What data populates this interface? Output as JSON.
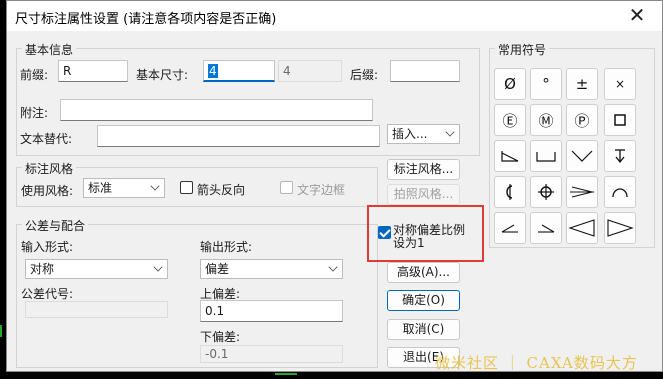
{
  "dialog": {
    "title": "尺寸标注属性设置 (请注意各项内容是否正确)",
    "close_glyph": "✕"
  },
  "basic_info": {
    "group_label": "基本信息",
    "prefix_label": "前缀:",
    "prefix_value": "R",
    "base_size_label": "基本尺寸:",
    "base_size_value": "4",
    "base_size_computed": "4",
    "suffix_label": "后缀:",
    "suffix_value": "",
    "note_label": "附注:",
    "note_value": "",
    "text_replace_label": "文本替代:",
    "text_replace_value": "",
    "insert_label": "插入..."
  },
  "annotation_style": {
    "group_label": "标注风格",
    "use_style_label": "使用风格:",
    "use_style_value": "标准",
    "arrow_reverse_label": "箭头反向",
    "arrow_reverse_checked": false,
    "text_border_label": "文字边框",
    "text_border_checked": false,
    "text_border_enabled": false,
    "style_button": "标注风格...",
    "photo_style_button": "拍照风格..."
  },
  "tolerance": {
    "group_label": "公差与配合",
    "input_form_label": "输入形式:",
    "input_form_value": "对称",
    "output_form_label": "输出形式:",
    "output_form_value": "偏差",
    "tolerance_code_label": "公差代号:",
    "tolerance_code_value": "",
    "upper_dev_label": "上偏差:",
    "upper_dev_value": "0.1",
    "lower_dev_label": "下偏差:",
    "lower_dev_value": "-0.1",
    "symmetric_scale_label": "对称偏差比例设为1",
    "symmetric_scale_line1": "对称偏差比例",
    "symmetric_scale_line2": "设为1",
    "symmetric_scale_checked": true
  },
  "actions": {
    "advanced": "高级(A)...",
    "ok": "确定(O)",
    "cancel": "取消(C)",
    "exit": "退出(E)"
  },
  "symbols": {
    "group_label": "常用符号",
    "items": [
      "diameter-symbol",
      "degree-symbol",
      "plus-minus-symbol",
      "multiply-symbol",
      "circled-E-symbol",
      "circled-M-symbol",
      "circled-P-symbol",
      "square-symbol",
      "slope-symbol",
      "counterbore-symbol",
      "countersink-symbol",
      "depth-symbol",
      "conical-taper-symbol",
      "position-symbol",
      "taper-arrow-symbol",
      "arc-length-symbol",
      "angle-left-symbol",
      "angle-right-symbol",
      "triangle-left-symbol",
      "triangle-right-symbol"
    ]
  },
  "watermark": "微米社区 ｜ CAXA数码大方"
}
